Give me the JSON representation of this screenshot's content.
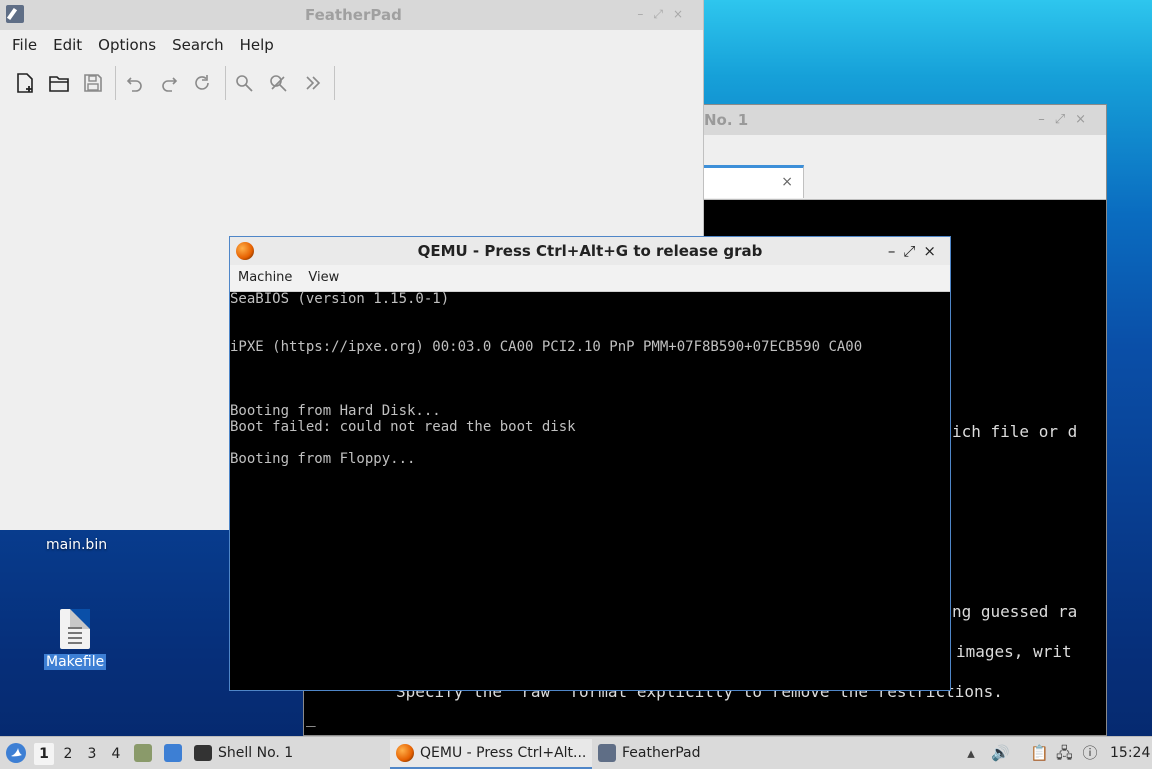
{
  "desktop": {
    "icons": [
      {
        "label": "main.bin"
      },
      {
        "label": "Makefile"
      }
    ]
  },
  "shell_window": {
    "title_partial": "No. 1",
    "tab_close": "×",
    "buttons": [
      "–",
      "⤢",
      "×"
    ],
    "terminal_fragments": [
      "ich file or d",
      "ng guessed ra",
      "images, writ",
      "Specify the 'raw' format explicitly to remove the restrictions.",
      "_"
    ]
  },
  "featherpad": {
    "title": "FeatherPad",
    "buttons": [
      "–",
      "⤢",
      "×"
    ],
    "menu": [
      "File",
      "Edit",
      "Options",
      "Search",
      "Help"
    ],
    "toolbar": {
      "new": "new-file-icon",
      "open": "open-folder-icon",
      "save": "save-icon",
      "undo": "undo-icon",
      "redo": "redo-icon",
      "reload": "reload-icon",
      "find": "find-icon",
      "replace": "replace-icon",
      "more": "more-icon"
    }
  },
  "qemu": {
    "title": "QEMU - Press Ctrl+Alt+G to release grab",
    "buttons": [
      "–",
      "⤢",
      "×"
    ],
    "menu": [
      "Machine",
      "View"
    ],
    "screen_lines": [
      "SeaBIOS (version 1.15.0-1)",
      "iPXE (https://ipxe.org) 00:03.0 CA00 PCI2.10 PnP PMM+07F8B590+07ECB590 CA00",
      "Booting from Hard Disk...",
      "Boot failed: could not read the boot disk",
      "Booting from Floppy..."
    ]
  },
  "taskbar": {
    "workspaces": [
      "1",
      "2",
      "3",
      "4"
    ],
    "active_workspace": "1",
    "tasks": [
      {
        "label": "Shell No. 1"
      },
      {
        "label": "QEMU - Press Ctrl+Alt..."
      },
      {
        "label": "FeatherPad"
      }
    ],
    "clock": "15:24"
  },
  "colors": {
    "accent": "#4f86c8",
    "terminal_bg": "#000000"
  }
}
